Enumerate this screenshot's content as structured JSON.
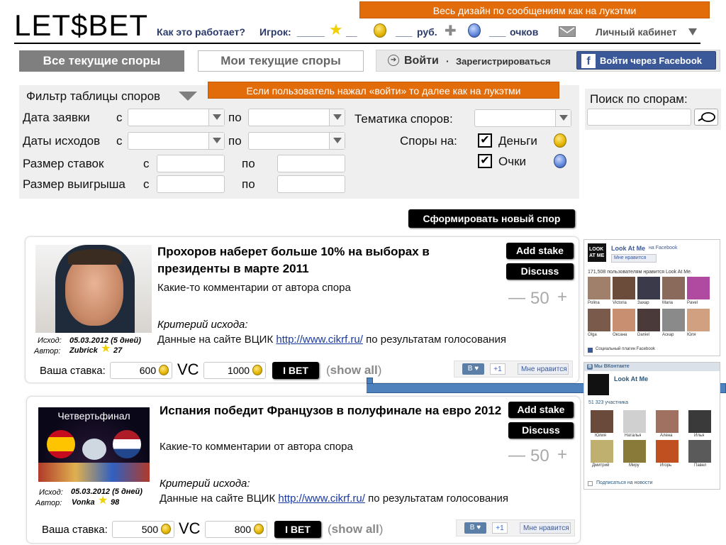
{
  "header": {
    "logo": "LET$BET",
    "how_it_works": "Как это работает?",
    "player_label": "Игрок:",
    "player_blank": "_____",
    "stars_blank": "__",
    "rub_blank": "___",
    "rub_label": "руб.",
    "points_blank": "___",
    "points_label": "очков",
    "cabinet": "Личный кабинет",
    "note_design": "Весь дизайн по сообщениям как на лукэтми"
  },
  "tabs": {
    "all_disputes": "Все текущие споры",
    "my_disputes": "Мои текущие споры"
  },
  "auth": {
    "login": "Войти",
    "separator": "·",
    "register": "Зарегистрироваться",
    "facebook": "Войти через Facebook",
    "note_login": "Если пользователь нажал «войти» то далее как на лукэтми"
  },
  "filter": {
    "title": "Фильтр таблицы споров",
    "date_request": "Дата заявки",
    "date_outcome": "Даты исходов",
    "bet_size": "Размер ставок",
    "win_size": "Размер выигрыша",
    "from": "с",
    "to": "по",
    "topic": "Тематика споров:",
    "disputes_on": "Споры на:",
    "money": "Деньги",
    "points": "Очки",
    "money_checked": "✔",
    "points_checked": "✔"
  },
  "search": {
    "label": "Поиск по спорам:"
  },
  "create_button": "Сформировать новый спор",
  "cards": [
    {
      "title": "Прохоров наберет больше 10% на выборах в президенты в марте 2011",
      "comment": "Какие-то комментарии от автора спора",
      "criteria_label": "Критерий исхода:",
      "criteria_prefix": "Данные на сайте ВЦИК",
      "criteria_link": "http://www.cikrf.ru/",
      "criteria_suffix": "по результатам голосования",
      "outcome_label": "Исход:",
      "outcome_value": "05.03.2012 (5 дней)",
      "author_label": "Автор:",
      "author_name": "Zubrick",
      "author_rating": "27",
      "add_stake": "Add stake",
      "discuss": "Discuss",
      "minus": "—",
      "step_value": "50",
      "plus": "+",
      "your_bet_label": "Ваша ставка:",
      "bet_value": "600",
      "vs_label": "VC",
      "opponent_value": "1000",
      "ibet": "I BET",
      "show_all_open": "(",
      "show_all": "show all",
      "show_all_close": ")",
      "vk": "B ♥",
      "plus_one": "+1",
      "fb_like": "Мне нравится"
    },
    {
      "title": "Испания победит Французов в полуфинале на евро 2012",
      "image_caption": "Четвертьфинал",
      "comment": "Какие-то комментарии от автора спора",
      "criteria_label": "Критерий исхода:",
      "criteria_prefix": "Данные на сайте ВЦИК",
      "criteria_link": "http://www.cikrf.ru/",
      "criteria_suffix": "по результатам голосования",
      "outcome_label": "Исход:",
      "outcome_value": "05.03.2012 (5 дней)",
      "author_label": "Автор:",
      "author_name": "Vonka",
      "author_rating": "98",
      "add_stake": "Add stake",
      "discuss": "Discuss",
      "minus": "—",
      "step_value": "50",
      "plus": "+",
      "your_bet_label": "Ваша ставка:",
      "bet_value": "500",
      "vs_label": "VC",
      "opponent_value": "800",
      "ibet": "I BET",
      "show_all_open": "(",
      "show_all": "show all",
      "show_all_close": ")",
      "vk": "B ♥",
      "plus_one": "+1",
      "fb_like": "Мне нравится"
    }
  ],
  "widget_fb": {
    "logo": "LOOK AT ME",
    "name": "Look At Me",
    "on_facebook": "на Facebook",
    "like": "Мне нравится",
    "count_text": "171,508 пользователям нравится Look At Me.",
    "people": [
      "Polina",
      "Victoria",
      "Захар",
      "Maria",
      "Pavel",
      "Olga",
      "Оксана",
      "Daniel",
      "Аскар",
      "Юля"
    ],
    "plugin": "Социальный плагин Facebook"
  },
  "widget_vk": {
    "header": "Мы ВКонтакте",
    "name": "Look At Me",
    "count": "51 323 участника",
    "people": [
      "Юлия",
      "Наталья",
      "Алена",
      "Илья",
      "Дмитрий",
      "Миру",
      "Игорь",
      "Павел"
    ],
    "subscribe": "Подписаться на новости"
  }
}
